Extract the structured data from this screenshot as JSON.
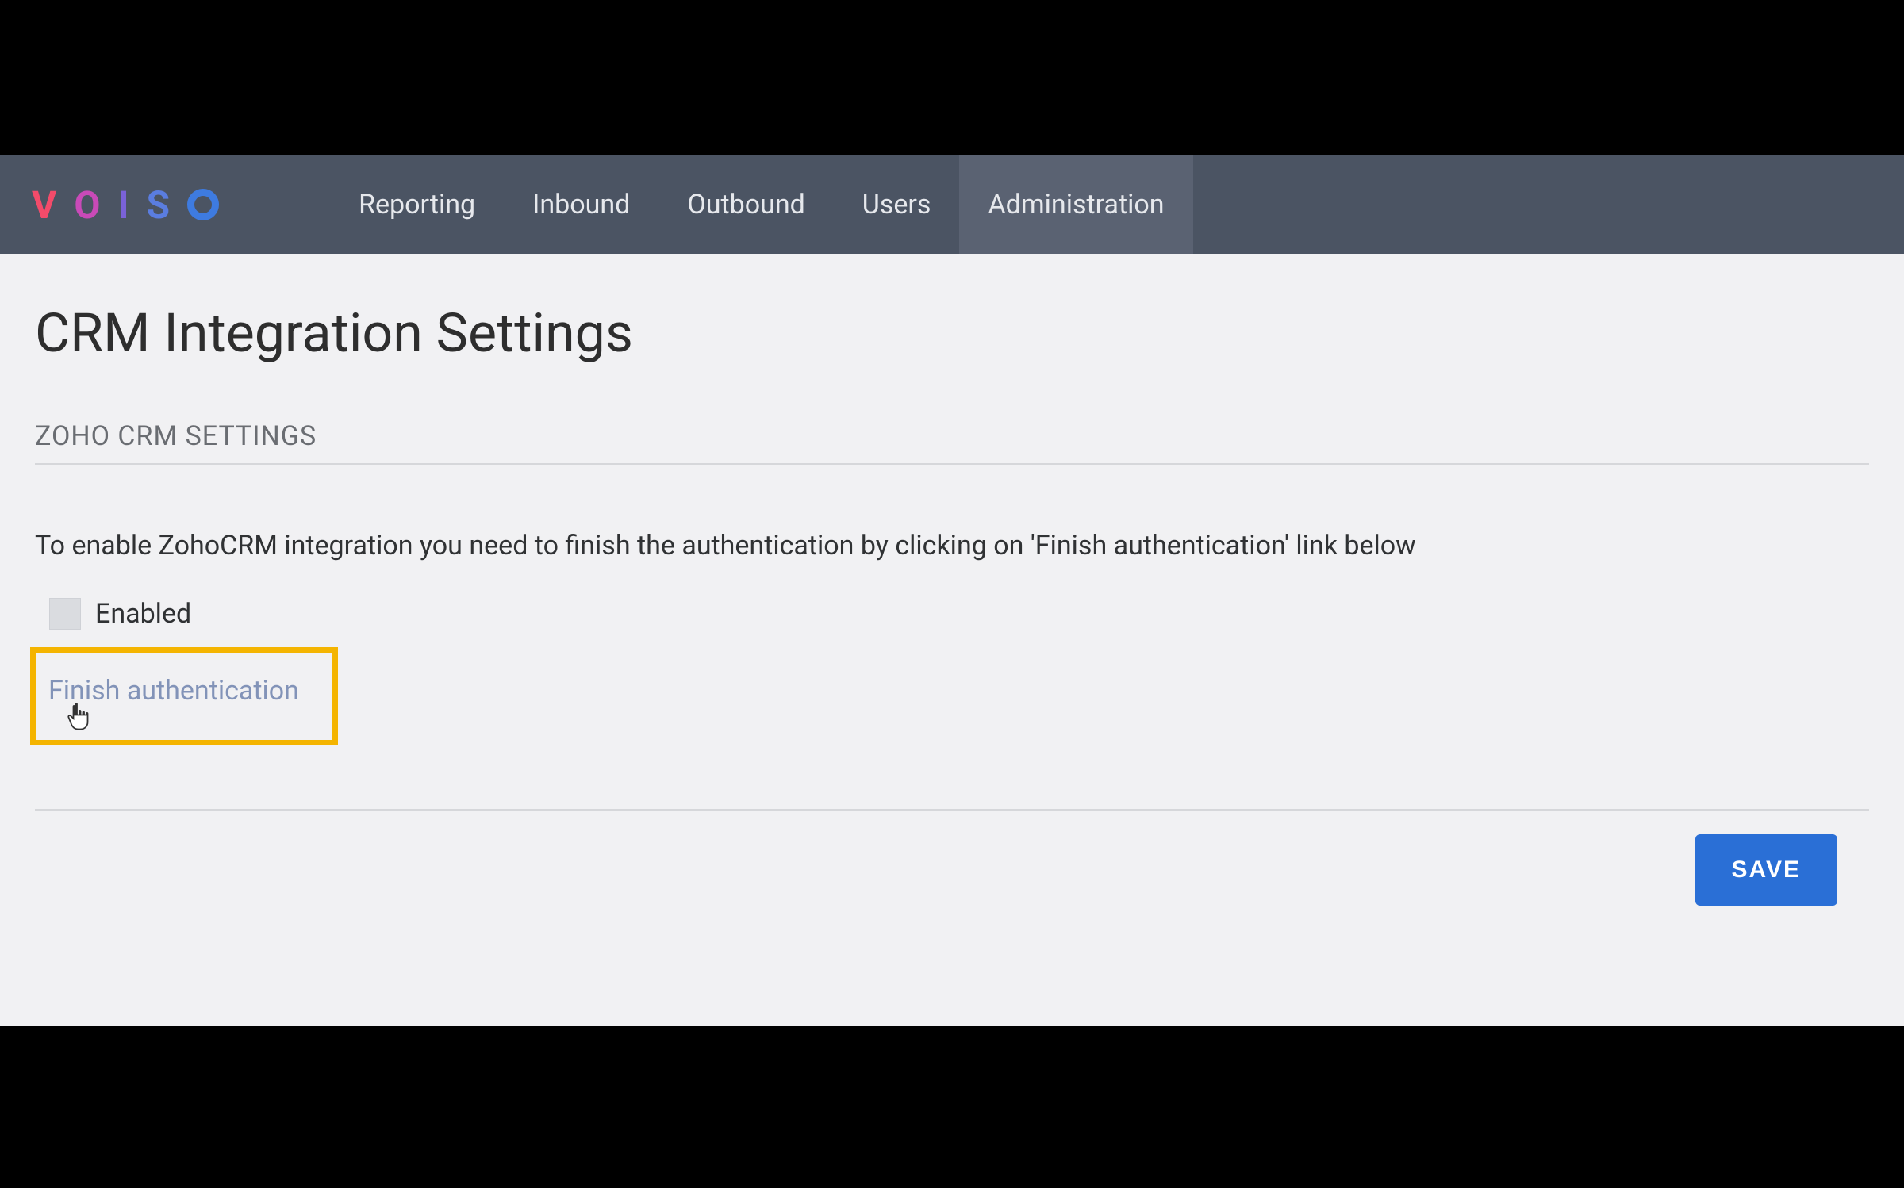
{
  "logo": {
    "v": "V",
    "o1": "O",
    "i": "I",
    "s": "S"
  },
  "nav": {
    "items": [
      {
        "label": "Reporting",
        "active": false
      },
      {
        "label": "Inbound",
        "active": false
      },
      {
        "label": "Outbound",
        "active": false
      },
      {
        "label": "Users",
        "active": false
      },
      {
        "label": "Administration",
        "active": true
      }
    ]
  },
  "page": {
    "title": "CRM Integration Settings",
    "section_title": "ZOHO CRM SETTINGS",
    "instruction": "To enable ZohoCRM integration you need to finish the authentication by clicking on 'Finish authentication' link below",
    "enabled_label": "Enabled",
    "auth_link": "Finish authentication",
    "save_button": "SAVE"
  },
  "colors": {
    "highlight_border": "#f4b400",
    "save_bg": "#2a6fd6",
    "nav_bg": "#4b5463"
  }
}
